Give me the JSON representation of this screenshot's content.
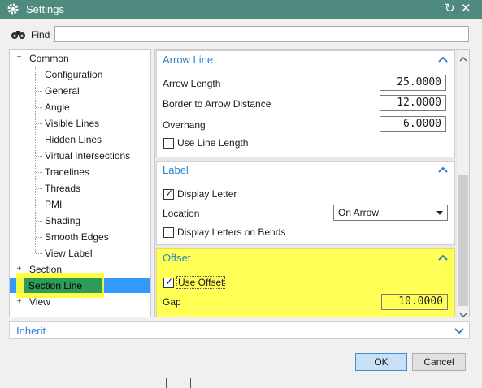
{
  "window": {
    "title": "Settings"
  },
  "toolbar": {
    "find_label": "Find",
    "find_value": ""
  },
  "tree": {
    "common": "Common",
    "children": [
      "Configuration",
      "General",
      "Angle",
      "Visible Lines",
      "Hidden Lines",
      "Virtual Intersections",
      "Tracelines",
      "Threads",
      "PMI",
      "Shading",
      "Smooth Edges",
      "View Label"
    ],
    "section": "Section",
    "section_line": "Section Line",
    "view": "View"
  },
  "arrow_line": {
    "title": "Arrow Line",
    "arrow_length_label": "Arrow Length",
    "arrow_length_value": "25.0000",
    "border_label": "Border to Arrow Distance",
    "border_value": "12.0000",
    "overhang_label": "Overhang",
    "overhang_value": "6.0000",
    "use_line_length_label": "Use Line Length"
  },
  "label": {
    "title": "Label",
    "display_letter_label": "Display Letter",
    "location_label": "Location",
    "location_value": "On Arrow",
    "display_on_bends_label": "Display Letters on Bends"
  },
  "offset": {
    "title": "Offset",
    "use_offset_label": "Use Offset",
    "gap_label": "Gap",
    "gap_value": "10.0000"
  },
  "inherit": {
    "label": "Inherit"
  },
  "buttons": {
    "ok": "OK",
    "cancel": "Cancel"
  },
  "icons": {
    "settings": "gear-icon",
    "reset": "reset-icon",
    "close": "close-icon",
    "find": "binoculars-icon"
  },
  "colors": {
    "titlebar": "#4f8a7f",
    "section_title": "#2f82c9",
    "highlight": "#ffff33",
    "selection": "#3399ff",
    "tree_selected": "#2e9b58"
  }
}
